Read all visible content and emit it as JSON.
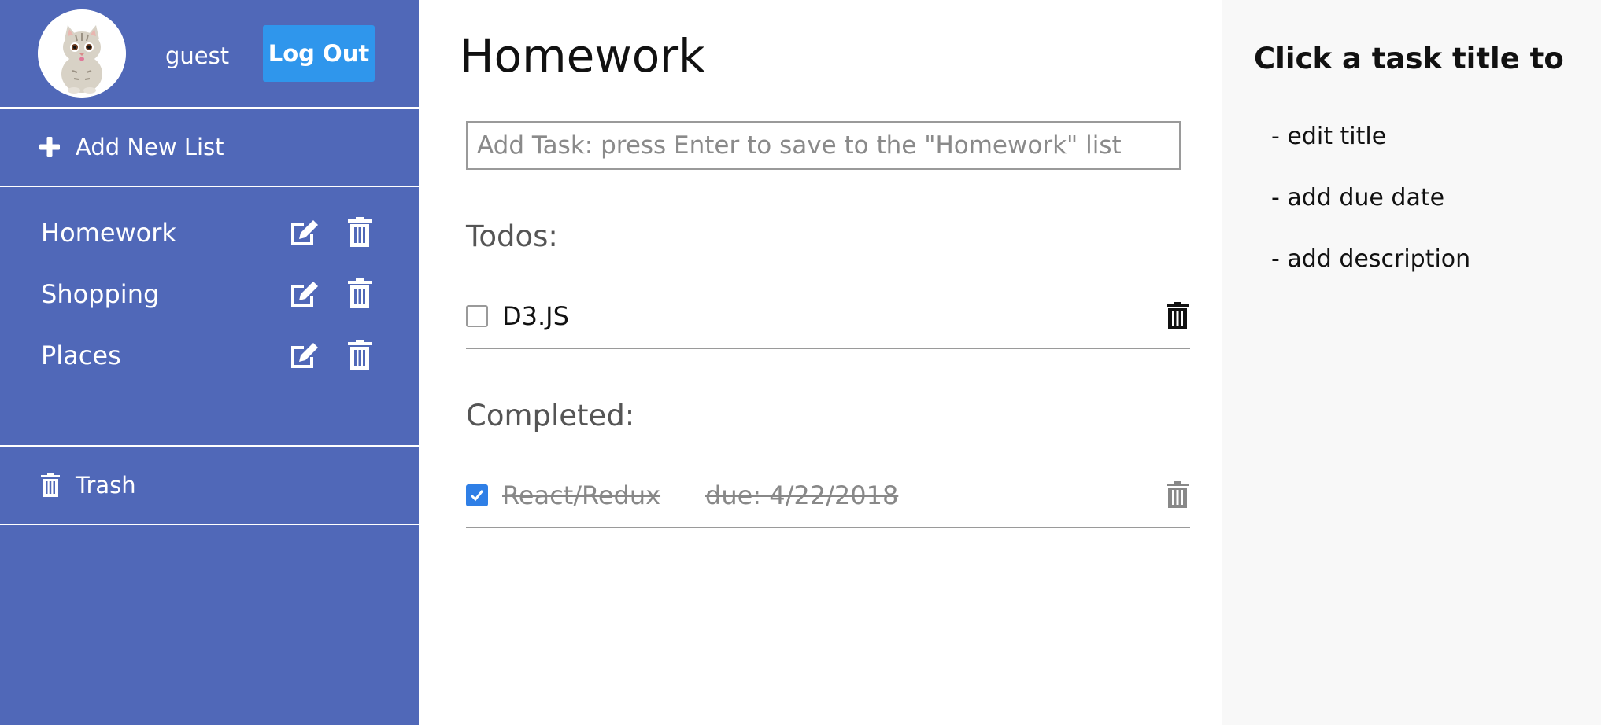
{
  "user": {
    "name": "guest",
    "logout_label": "Log Out"
  },
  "sidebar": {
    "add_list_label": "Add New List",
    "lists": [
      {
        "label": "Homework"
      },
      {
        "label": "Shopping"
      },
      {
        "label": "Places"
      }
    ],
    "trash_label": "Trash"
  },
  "main": {
    "title": "Homework",
    "input_placeholder": "Add Task: press Enter to save to the \"Homework\" list",
    "todos_heading": "Todos:",
    "todos": [
      {
        "title": "D3.JS",
        "checked": false
      }
    ],
    "completed_heading": "Completed:",
    "completed": [
      {
        "title": "React/Redux",
        "due": "due: 4/22/2018",
        "checked": true
      }
    ]
  },
  "help": {
    "title": "Click a task title to",
    "items": [
      "- edit title",
      "- add due date",
      "- add description"
    ]
  },
  "colors": {
    "sidebar_bg": "#5068b8",
    "button_blue": "#2f96ec",
    "checkbox_blue": "#2f7fe6",
    "help_bg": "#f8f8f8"
  },
  "icons": {
    "add": "plus-icon",
    "edit": "edit-icon",
    "delete": "trash-icon",
    "avatar": "cat-avatar"
  }
}
